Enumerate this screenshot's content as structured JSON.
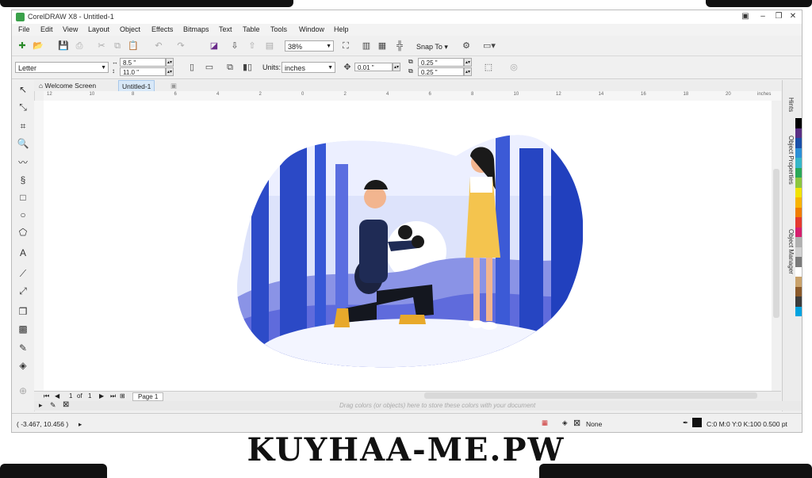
{
  "window": {
    "title": "CorelDRAW X8 - Untitled-1",
    "controls": [
      "minimize",
      "restore",
      "close"
    ]
  },
  "menu": [
    "File",
    "Edit",
    "View",
    "Layout",
    "Object",
    "Effects",
    "Bitmaps",
    "Text",
    "Table",
    "Tools",
    "Window",
    "Help"
  ],
  "toolbar": {
    "zoom": "38%",
    "snap_label": "Snap To"
  },
  "property_bar": {
    "page_size": "Letter",
    "width": "8.5 \"",
    "height": "11.0 \"",
    "units_label": "Units:",
    "units_value": "inches",
    "nudge": "0.01 \"",
    "dup_x": "0.25 \"",
    "dup_y": "0.25 \""
  },
  "tabs": [
    "Welcome Screen",
    "Untitled-1"
  ],
  "ruler": {
    "h_ticks": [
      "12",
      "10",
      "8",
      "6",
      "4",
      "2",
      "0",
      "2",
      "4",
      "6",
      "8",
      "10",
      "12",
      "14",
      "16",
      "18",
      "20"
    ],
    "unit": "inches"
  },
  "dockers": [
    "Hints",
    "Object Properties",
    "Object Manager"
  ],
  "page_nav": {
    "current": "1",
    "of_label": "of",
    "total": "1",
    "page_tab": "Page 1"
  },
  "swatch_hint": "Drag colors (or objects) here to store these colors with your document",
  "status": {
    "coords": "( -3.467, 10.456 )",
    "fill": "None",
    "outline": "C:0 M:0 Y:0 K:100  0.500 pt"
  },
  "palette": [
    "#000000",
    "#5a2f84",
    "#1a4fa8",
    "#2b8fd6",
    "#36b6c9",
    "#2aa859",
    "#8cc63f",
    "#f2e300",
    "#f8b400",
    "#f07d00",
    "#e53a2f",
    "#d61f6e",
    "#b0b0b0",
    "#d0d0d0",
    "#7a7a7a",
    "#ffffff",
    "#c9a26b",
    "#8b5a2b",
    "#3c3c3c",
    "#00a3e0"
  ],
  "watermark": "KUYHAA-ME.PW"
}
